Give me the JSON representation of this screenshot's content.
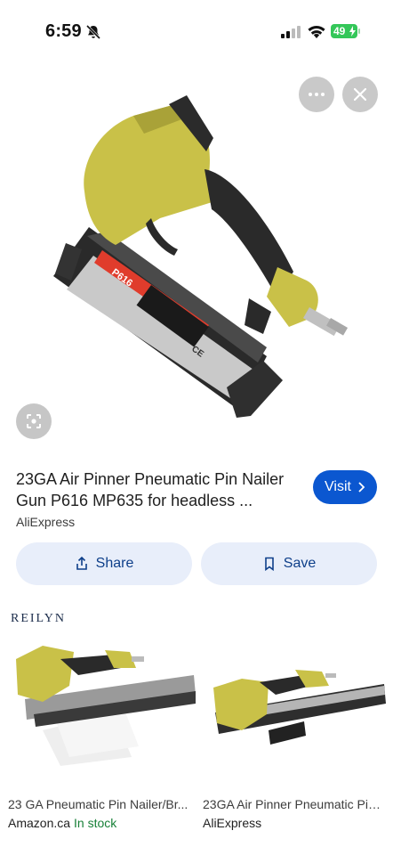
{
  "status_bar": {
    "time": "6:59",
    "battery": "49"
  },
  "result": {
    "title": "23GA Air Pinner Pneumatic Pin Nailer Gun P616 MP635 for headless ...",
    "source": "AliExpress",
    "visit_label": "Visit"
  },
  "actions": {
    "share_label": "Share",
    "save_label": "Save"
  },
  "image_labels": {
    "model": "P616",
    "ce_mark": "CE"
  },
  "related": {
    "brand_logo": "REILYN",
    "cards": [
      {
        "title": "23 GA Pneumatic Pin Nailer/Br...",
        "source": "Amazon.ca",
        "stock": "In stock"
      },
      {
        "title": "23GA Air Pinner Pneumatic Pin...",
        "source": "AliExpress"
      }
    ]
  },
  "colors": {
    "visit_button": "#0b57d0",
    "action_button": "#e8eefa",
    "in_stock": "#188038",
    "tool_body": "#c9c148"
  }
}
